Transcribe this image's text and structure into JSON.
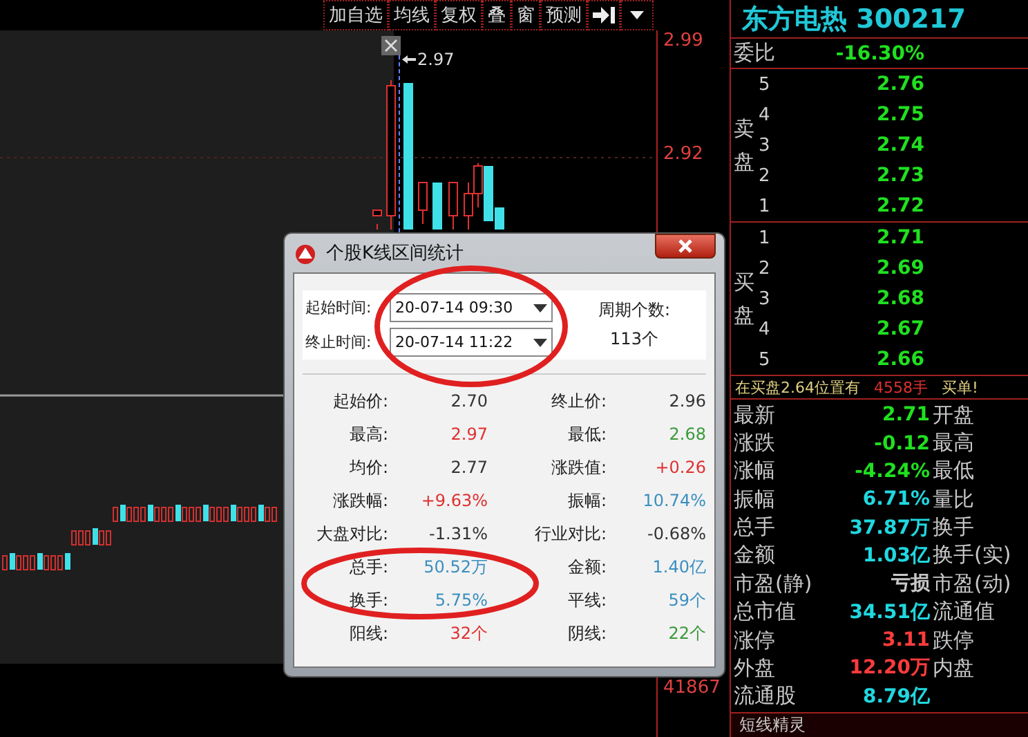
{
  "toolbar": {
    "buttons": [
      "加自选",
      "均线",
      "复权",
      "叠",
      "窗",
      "预测"
    ]
  },
  "price_axis": {
    "labels": [
      "2.99",
      "2.92"
    ],
    "volume_label": "41867"
  },
  "chart": {
    "marker": "2.97"
  },
  "dialog": {
    "title": "个股K线区间统计",
    "range": [
      {
        "label": "起始时间:",
        "value": "20-07-14 09:30"
      },
      {
        "label": "终止时间:",
        "value": "20-07-14 11:22"
      }
    ],
    "period": {
      "label": "周期个数:",
      "value": "113个"
    },
    "stats": [
      {
        "label": "起始价:",
        "value": "2.70",
        "color": "#333333"
      },
      {
        "label": "终止价:",
        "value": "2.96",
        "color": "#333333"
      },
      {
        "label": "最高:",
        "value": "2.97",
        "color": "#e03030"
      },
      {
        "label": "最低:",
        "value": "2.68",
        "color": "#3a9a3a"
      },
      {
        "label": "均价:",
        "value": "2.77",
        "color": "#333333"
      },
      {
        "label": "涨跌值:",
        "value": "+0.26",
        "color": "#e03030"
      },
      {
        "label": "涨跌幅:",
        "value": "+9.63%",
        "color": "#e03030"
      },
      {
        "label": "振幅:",
        "value": "10.74%",
        "color": "#3a8fbf"
      },
      {
        "label": "大盘对比:",
        "value": "-1.31%",
        "color": "#333333"
      },
      {
        "label": "行业对比:",
        "value": "-0.68%",
        "color": "#333333"
      },
      {
        "label": "总手:",
        "value": "50.52万",
        "color": "#3a8fbf"
      },
      {
        "label": "金额:",
        "value": "1.40亿",
        "color": "#3a8fbf"
      },
      {
        "label": "换手:",
        "value": "5.75%",
        "color": "#3a8fbf"
      },
      {
        "label": "平线:",
        "value": "59个",
        "color": "#3a8fbf"
      },
      {
        "label": "阳线:",
        "value": "32个",
        "color": "#e03030"
      },
      {
        "label": "阴线:",
        "value": "22个",
        "color": "#3a9a3a"
      }
    ]
  },
  "quote": {
    "title": "东方电热 300217",
    "ratio": {
      "label": "委比",
      "value": "-16.30%"
    },
    "sell": {
      "label": "卖盘",
      "levels": [
        {
          "level": "5",
          "price": "2.76"
        },
        {
          "level": "4",
          "price": "2.75"
        },
        {
          "level": "3",
          "price": "2.74"
        },
        {
          "level": "2",
          "price": "2.73"
        },
        {
          "level": "1",
          "price": "2.72"
        }
      ]
    },
    "buy": {
      "label": "买盘",
      "levels": [
        {
          "level": "1",
          "price": "2.71"
        },
        {
          "level": "2",
          "price": "2.69"
        },
        {
          "level": "3",
          "price": "2.68"
        },
        {
          "level": "4",
          "price": "2.67"
        },
        {
          "level": "5",
          "price": "2.66"
        }
      ]
    },
    "alert": {
      "text": "在买盘2.64位置有",
      "volume": "4558手",
      "suffix": "买单!"
    },
    "stats": [
      {
        "label": "最新",
        "value": "2.71",
        "color": "#20e020",
        "label_2": "开盘"
      },
      {
        "label": "涨跌",
        "value": "-0.12",
        "color": "#20e020",
        "label_2": "最高"
      },
      {
        "label": "涨幅",
        "value": "-4.24%",
        "color": "#20e020",
        "label_2": "最低"
      },
      {
        "label": "振幅",
        "value": "6.71%",
        "color": "#20d8e0",
        "label_2": "量比"
      },
      {
        "label": "总手",
        "value": "37.87万",
        "color": "#20d8e0",
        "label_2": "换手"
      },
      {
        "label": "金额",
        "value": "1.03亿",
        "color": "#20d8e0",
        "label_2": "换手(实)"
      },
      {
        "label": "市盈(静)",
        "value": "亏损",
        "color": "#c8c8c8",
        "label_2": "市盈(动)"
      },
      {
        "label": "总市值",
        "value": "34.51亿",
        "color": "#20d8e0",
        "label_2": "流通值"
      },
      {
        "label": "涨停",
        "value": "3.11",
        "color": "#ff3c3c",
        "label_2": "跌停"
      },
      {
        "label": "外盘",
        "value": "12.20万",
        "color": "#ff3c3c",
        "label_2": "内盘"
      },
      {
        "label": "流通股",
        "value": "8.79亿",
        "color": "#20d8e0"
      }
    ],
    "footer": "短线精灵"
  }
}
